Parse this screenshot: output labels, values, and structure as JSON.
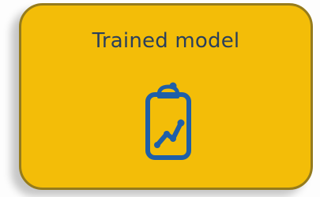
{
  "node": {
    "title": "Trained model",
    "icon": "clipboard-chart-icon",
    "fill_color": "#f3bd08",
    "border_color": "#957b1c",
    "icon_color": "#1f5fa8",
    "text_color": "#2a3f5c"
  }
}
